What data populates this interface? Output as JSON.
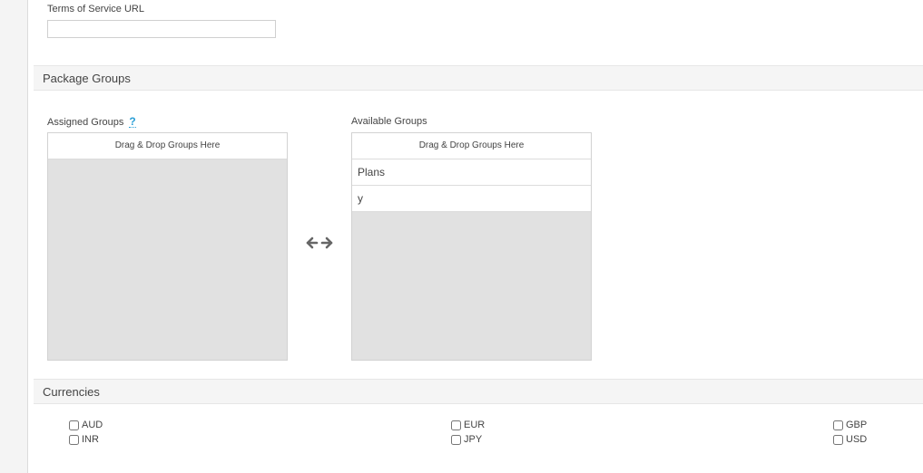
{
  "terms": {
    "label": "Terms of Service URL",
    "value": ""
  },
  "package_groups": {
    "title": "Package Groups",
    "assigned": {
      "label": "Assigned Groups",
      "help": "?",
      "drop_hint": "Drag & Drop Groups Here",
      "items": []
    },
    "available": {
      "label": "Available Groups",
      "drop_hint": "Drag & Drop Groups Here",
      "items": [
        "Plans",
        "y"
      ]
    },
    "swap_icon": "left-right-arrows-icon"
  },
  "currencies": {
    "title": "Currencies",
    "options": [
      {
        "code": "AUD",
        "checked": false
      },
      {
        "code": "INR",
        "checked": false
      },
      {
        "code": "EUR",
        "checked": false
      },
      {
        "code": "JPY",
        "checked": false
      },
      {
        "code": "GBP",
        "checked": false
      },
      {
        "code": "USD",
        "checked": false
      }
    ]
  }
}
